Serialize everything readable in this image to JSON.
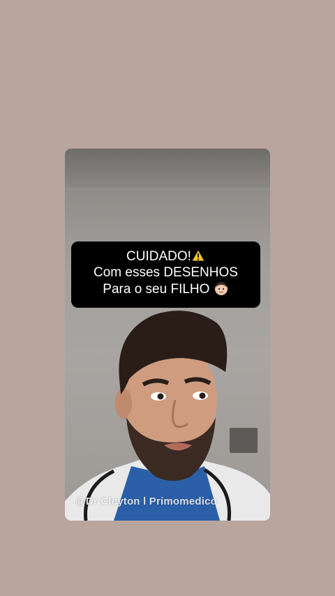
{
  "caption": {
    "line1": "CUIDADO!",
    "line1_icon": "warning-icon",
    "line2": "Com esses DESENHOS",
    "line3": "Para o seu FILHO",
    "line3_icon": "man-face-emoji"
  },
  "watermark": "@Dr Cleyton l Primomedico",
  "colors": {
    "background": "#b8a59e",
    "caption_bg": "#000000",
    "caption_text": "#ffffff"
  }
}
